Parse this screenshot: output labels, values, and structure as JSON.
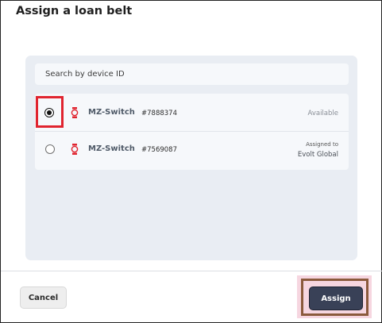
{
  "dialog": {
    "title": "Assign a loan belt"
  },
  "search": {
    "placeholder": "Search by device ID"
  },
  "devices": [
    {
      "name": "MZ-Switch",
      "id": "#7888374",
      "status": "Available",
      "selected": true,
      "icon": "watch-icon"
    },
    {
      "name": "MZ-Switch",
      "id": "#7569087",
      "status_label": "Assigned to",
      "assigned_org": "Evolt Global",
      "selected": false,
      "icon": "watch-icon"
    }
  ],
  "footer": {
    "cancel_label": "Cancel",
    "assign_label": "Assign"
  },
  "colors": {
    "accent_icon": "#e0242f",
    "primary_button": "#394157",
    "highlight_red": "#e0242f",
    "highlight_brown": "#8b5a3c"
  }
}
